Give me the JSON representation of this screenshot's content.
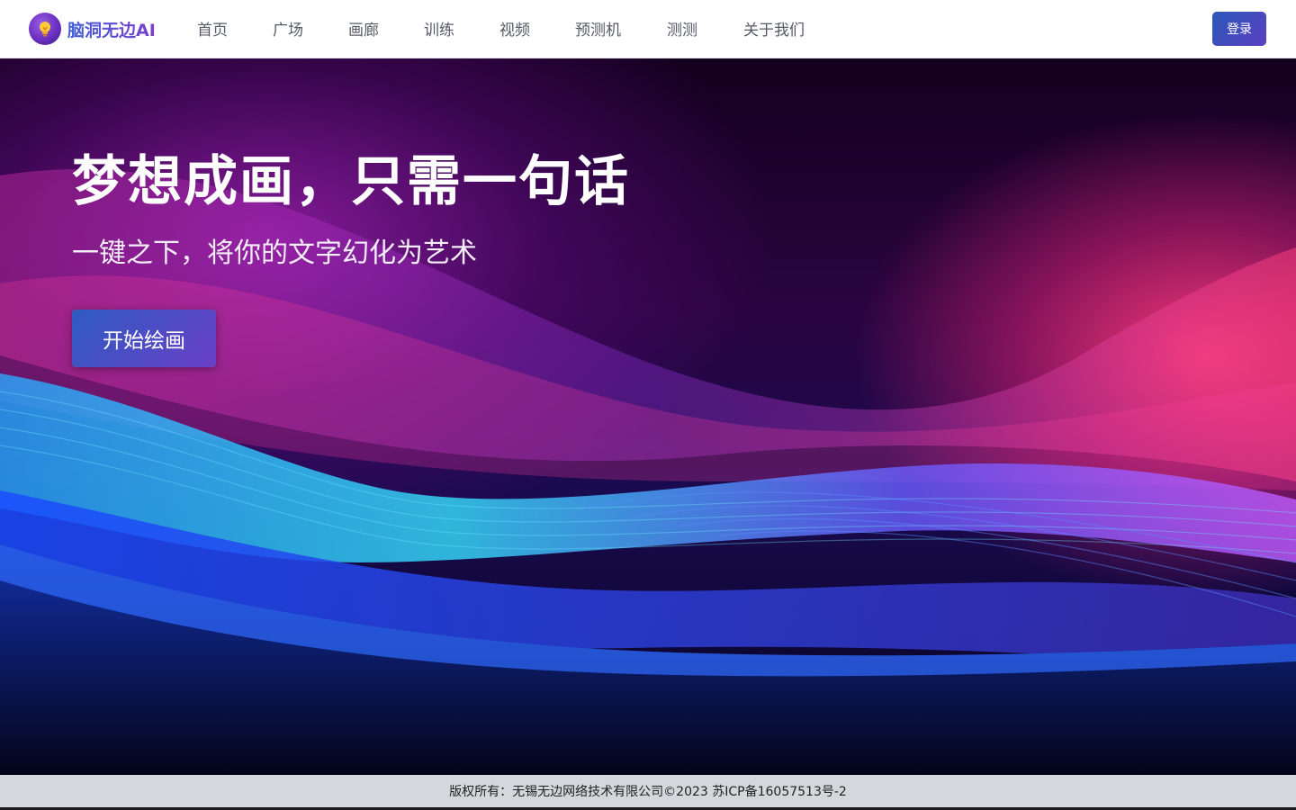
{
  "brand": {
    "name": "脑洞无边AI",
    "icon": "lightbulb-icon",
    "accent_start": "#3f5fd6",
    "accent_end": "#7a3fd0"
  },
  "nav": {
    "items": [
      {
        "label": "首页"
      },
      {
        "label": "广场"
      },
      {
        "label": "画廊"
      },
      {
        "label": "训练"
      },
      {
        "label": "视频"
      },
      {
        "label": "预测机"
      },
      {
        "label": "测测"
      },
      {
        "label": "关于我们"
      }
    ],
    "login_label": "登录"
  },
  "hero": {
    "title": "梦想成画，只需一句话",
    "subtitle": "一键之下，将你的文字幻化为艺术",
    "cta_label": "开始绘画"
  },
  "footer": {
    "copyright": "版权所有：无锡无边网络技术有限公司©2023 苏ICP备16057513号-2"
  }
}
